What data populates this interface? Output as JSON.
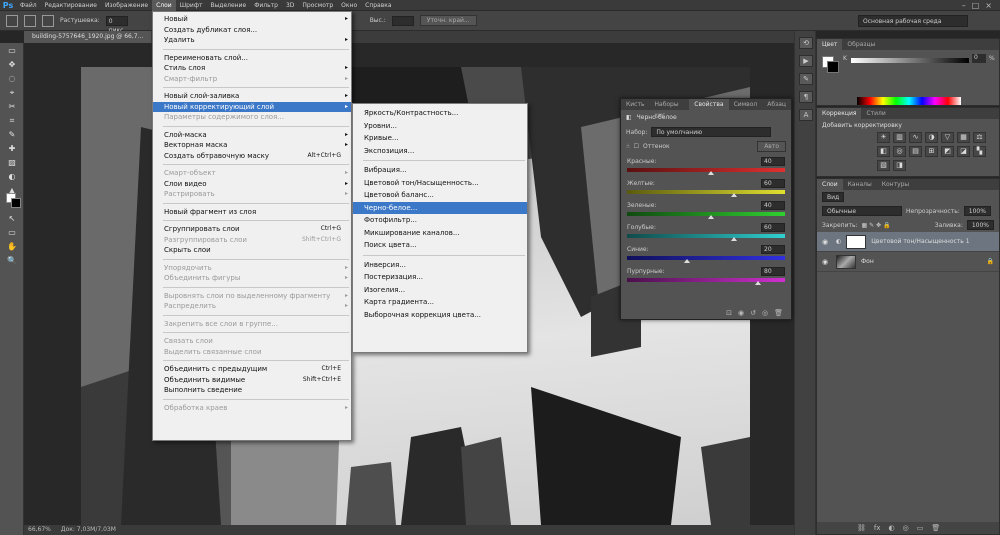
{
  "menubar": {
    "logo": "Ps",
    "items": [
      "Файл",
      "Редактирование",
      "Изображение",
      "Слои",
      "Шрифт",
      "Выделение",
      "Фильтр",
      "3D",
      "Просмотр",
      "Окно",
      "Справка"
    ],
    "window_controls": [
      "–",
      "□",
      "×"
    ]
  },
  "options": {
    "feather_label": "Растушевка:",
    "feather_value": "0 пикс",
    "height_label": "Выс.:",
    "refine_button": "Уточн. край...",
    "workspace": "Основная рабочая среда"
  },
  "document": {
    "tab": "building-5757646_1920.jpg @ 66,7...",
    "status_zoom": "66,67%",
    "status_doc": "Док: 7,03M/7,03M"
  },
  "tools": [
    "▭",
    "✥",
    "◌",
    "⌖",
    "✂",
    "⌗",
    "✎",
    "✚",
    "▨",
    "◐",
    "▲",
    "T",
    "↖",
    "▭",
    "✋",
    "🔍"
  ],
  "main_menu": [
    {
      "label": "Новый",
      "sub": true
    },
    {
      "label": "Создать дубликат слоя..."
    },
    {
      "label": "Удалить",
      "sub": true
    },
    {
      "sep": true
    },
    {
      "label": "Переименовать слой..."
    },
    {
      "label": "Стиль слоя",
      "sub": true
    },
    {
      "label": "Смарт-фильтр",
      "disabled": true,
      "sub": true
    },
    {
      "sep": true
    },
    {
      "label": "Новый слой-заливка",
      "sub": true
    },
    {
      "label": "Новый корректирующий слой",
      "sub": true,
      "hl": true
    },
    {
      "label": "Параметры содержимого слоя...",
      "disabled": true
    },
    {
      "sep": true
    },
    {
      "label": "Слой-маска",
      "sub": true
    },
    {
      "label": "Векторная маска",
      "sub": true
    },
    {
      "label": "Создать обтравочную маску",
      "shortcut": "Alt+Ctrl+G"
    },
    {
      "sep": true
    },
    {
      "label": "Смарт-объект",
      "disabled": true,
      "sub": true
    },
    {
      "label": "Слои видео",
      "sub": true
    },
    {
      "label": "Растрировать",
      "disabled": true,
      "sub": true
    },
    {
      "sep": true
    },
    {
      "label": "Новый фрагмент из слоя"
    },
    {
      "sep": true
    },
    {
      "label": "Сгруппировать слои",
      "shortcut": "Ctrl+G"
    },
    {
      "label": "Разгруппировать слои",
      "shortcut": "Shift+Ctrl+G",
      "disabled": true
    },
    {
      "label": "Скрыть слои"
    },
    {
      "sep": true
    },
    {
      "label": "Упорядочить",
      "disabled": true,
      "sub": true
    },
    {
      "label": "Объединить фигуры",
      "disabled": true,
      "sub": true
    },
    {
      "sep": true
    },
    {
      "label": "Выровнять слои по выделенному фрагменту",
      "disabled": true,
      "sub": true
    },
    {
      "label": "Распределить",
      "disabled": true,
      "sub": true
    },
    {
      "sep": true
    },
    {
      "label": "Закрепить все слои в группе...",
      "disabled": true
    },
    {
      "sep": true
    },
    {
      "label": "Связать слои",
      "disabled": true
    },
    {
      "label": "Выделить связанные слои",
      "disabled": true
    },
    {
      "sep": true
    },
    {
      "label": "Объединить с предыдущим",
      "shortcut": "Ctrl+E"
    },
    {
      "label": "Объединить видимые",
      "shortcut": "Shift+Ctrl+E"
    },
    {
      "label": "Выполнить сведение"
    },
    {
      "sep": true
    },
    {
      "label": "Обработка краев",
      "disabled": true,
      "sub": true
    }
  ],
  "sub_menu": [
    {
      "label": "Яркость/Контрастность..."
    },
    {
      "label": "Уровни..."
    },
    {
      "label": "Кривые..."
    },
    {
      "label": "Экспозиция..."
    },
    {
      "sep": true
    },
    {
      "label": "Вибрация..."
    },
    {
      "label": "Цветовой тон/Насыщенность..."
    },
    {
      "label": "Цветовой баланс..."
    },
    {
      "label": "Черно-белое...",
      "hl": true
    },
    {
      "label": "Фотофильтр..."
    },
    {
      "label": "Микширование каналов..."
    },
    {
      "label": "Поиск цвета..."
    },
    {
      "sep": true
    },
    {
      "label": "Инверсия..."
    },
    {
      "label": "Постеризация..."
    },
    {
      "label": "Изогелия..."
    },
    {
      "label": "Карта градиента..."
    },
    {
      "label": "Выборочная коррекция цвета..."
    }
  ],
  "properties": {
    "tabs": [
      "Кисть",
      "Наборы кис",
      "Свойства",
      "Символ",
      "Абзац"
    ],
    "title": "Черно-белое",
    "preset_label": "Набор:",
    "preset_value": "По умолчанию",
    "tint_label": "Оттенок",
    "auto_button": "Авто",
    "channels": [
      {
        "name": "Красные:",
        "value": "40",
        "colors": [
          "#5a1010",
          "#e03030"
        ],
        "pos": 0.53
      },
      {
        "name": "Желтые:",
        "value": "60",
        "colors": [
          "#5a5a10",
          "#e0e030"
        ],
        "pos": 0.68
      },
      {
        "name": "Зеленые:",
        "value": "40",
        "colors": [
          "#104a10",
          "#30d030"
        ],
        "pos": 0.53
      },
      {
        "name": "Голубые:",
        "value": "60",
        "colors": [
          "#104a4a",
          "#30d0d0"
        ],
        "pos": 0.68
      },
      {
        "name": "Синие:",
        "value": "20",
        "colors": [
          "#10105a",
          "#3030e0"
        ],
        "pos": 0.38
      },
      {
        "name": "Пурпурные:",
        "value": "80",
        "colors": [
          "#4a104a",
          "#d030d0"
        ],
        "pos": 0.83
      }
    ]
  },
  "color_panel": {
    "tabs": [
      "Цвет",
      "Образцы"
    ],
    "k_label": "K",
    "k_value": "0",
    "k_unit": "%"
  },
  "corrections": {
    "tabs": [
      "Коррекция",
      "Стили"
    ],
    "title": "Добавить корректировку",
    "icons": [
      "☀",
      "▥",
      "∿",
      "◑",
      "▽",
      "▦",
      "⚖",
      "◧",
      "◎",
      "▤",
      "⊞",
      "◩",
      "◪",
      "▚",
      "▧",
      "◨"
    ]
  },
  "layers": {
    "tabs": [
      "Слои",
      "Каналы",
      "Контуры"
    ],
    "kind_label": "Вид",
    "blend_mode": "Обычные",
    "opacity_label": "Непрозрачность:",
    "opacity_value": "100%",
    "lock_label": "Закрепить:",
    "fill_label": "Заливка:",
    "fill_value": "100%",
    "items": [
      {
        "name": "Цветовой тон/Насыщенность 1",
        "selected": true
      },
      {
        "name": "Фон",
        "selected": false
      }
    ],
    "footer_icons": [
      "⛓",
      "fx",
      "◐",
      "◎",
      "▭",
      "🗑"
    ]
  }
}
